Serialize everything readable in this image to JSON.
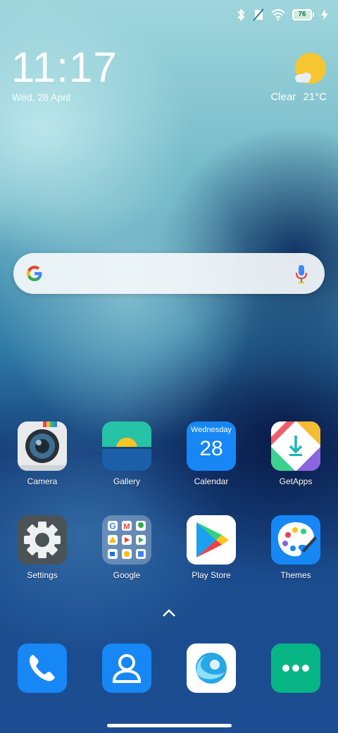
{
  "status_bar": {
    "icons": [
      "bluetooth-icon",
      "no-sim-icon",
      "wifi-icon",
      "battery-icon",
      "charging-bolt-icon"
    ],
    "battery_level": "76"
  },
  "clock": {
    "time": "11:17",
    "date": "Wed, 28 April"
  },
  "weather": {
    "condition": "Clear",
    "temperature": "21°C",
    "icon": "sun-with-cloud-icon"
  },
  "search_bar": {
    "left_icon": "google-g-icon",
    "right_icon": "microphone-icon"
  },
  "apps_row1": [
    {
      "label": "Camera",
      "icon": "camera-icon"
    },
    {
      "label": "Gallery",
      "icon": "gallery-icon"
    },
    {
      "label": "Calendar",
      "icon": "calendar-icon",
      "weekday": "Wednesday",
      "day": "28"
    },
    {
      "label": "GetApps",
      "icon": "getapps-icon"
    }
  ],
  "apps_row2": [
    {
      "label": "Settings",
      "icon": "gear-icon"
    },
    {
      "label": "Google",
      "icon": "google-folder-icon"
    },
    {
      "label": "Play Store",
      "icon": "play-store-icon"
    },
    {
      "label": "Themes",
      "icon": "palette-icon"
    }
  ],
  "dock": [
    {
      "icon": "phone-icon"
    },
    {
      "icon": "contacts-icon"
    },
    {
      "icon": "browser-icon"
    },
    {
      "icon": "messages-icon"
    }
  ],
  "colors": {
    "blue_app": "#1787f5",
    "green_app": "#07b585",
    "settings_grey": "#4a5356"
  }
}
